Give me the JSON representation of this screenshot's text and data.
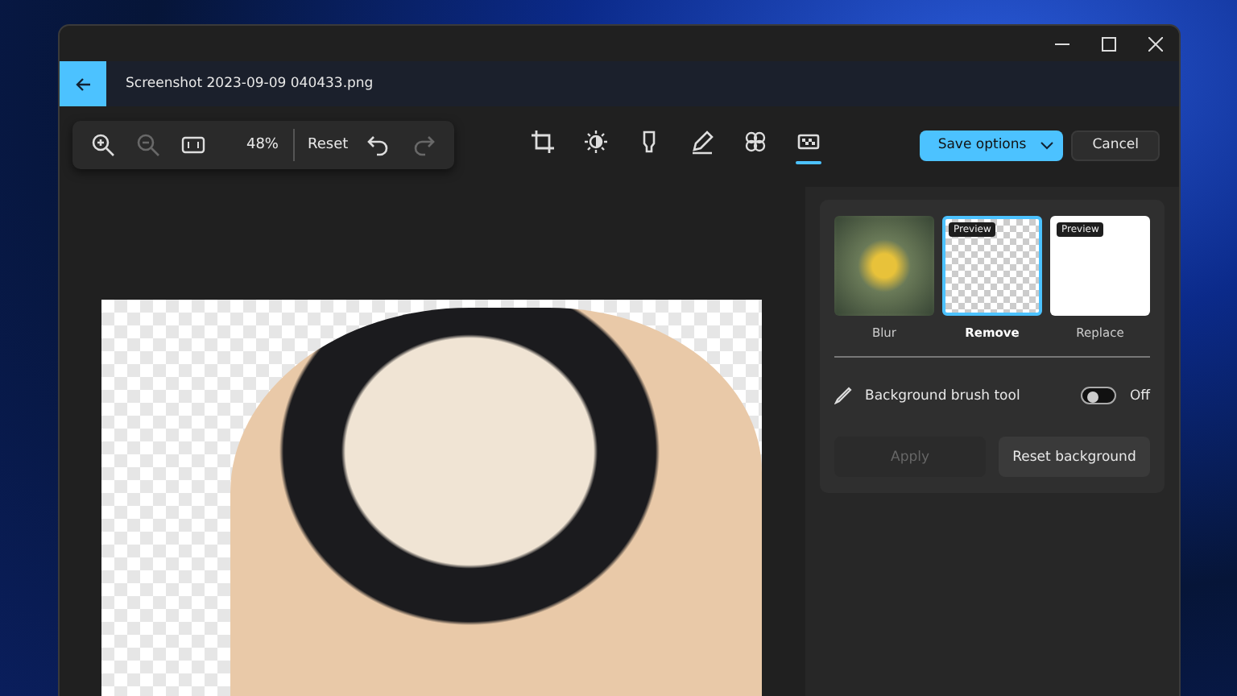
{
  "window": {
    "title": "Screenshot 2023-09-09 040433.png"
  },
  "view_controls": {
    "zoom_in": {
      "disabled": false
    },
    "zoom_out": {
      "disabled": true
    },
    "zoom_level": "48%",
    "reset": "Reset",
    "undo": {
      "disabled": false
    },
    "redo": {
      "disabled": true
    }
  },
  "tools": [
    {
      "kind": "crop",
      "selected": false
    },
    {
      "kind": "adjust",
      "selected": false
    },
    {
      "kind": "markup",
      "selected": false
    },
    {
      "kind": "draw",
      "selected": false
    },
    {
      "kind": "filter",
      "selected": false
    },
    {
      "kind": "background",
      "selected": true
    }
  ],
  "actions": {
    "save": "Save options",
    "cancel": "Cancel"
  },
  "background_panel": {
    "options": [
      {
        "label": "Blur",
        "kind": "blur",
        "selected": false
      },
      {
        "label": "Remove",
        "kind": "transparent",
        "selected": true,
        "badge": "Preview"
      },
      {
        "label": "Replace",
        "kind": "white",
        "selected": false,
        "badge": "Preview"
      }
    ],
    "brush_tool": {
      "label": "Background brush tool",
      "on": false,
      "state_label": "Off"
    },
    "apply": {
      "label": "Apply",
      "disabled": true
    },
    "reset_background": "Reset background"
  }
}
